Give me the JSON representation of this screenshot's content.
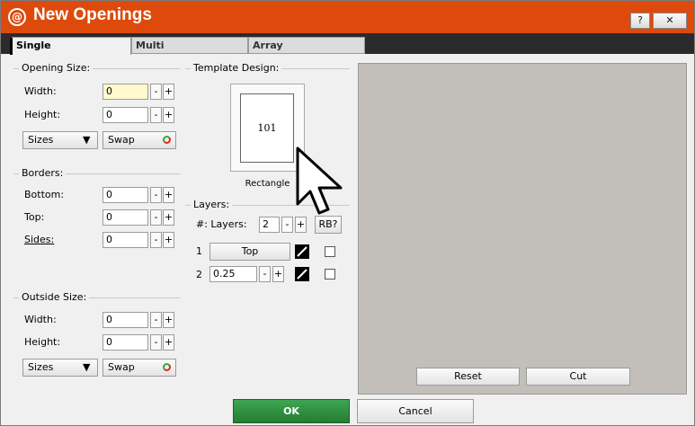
{
  "window": {
    "title": "New Openings",
    "logo": "@",
    "help_label": "?",
    "close_label": "✕"
  },
  "tabs": [
    {
      "label": "Single",
      "active": true
    },
    {
      "label": "Multi",
      "active": false
    },
    {
      "label": "Array",
      "active": false
    }
  ],
  "opening_size": {
    "group_label": "Opening Size:",
    "width_label": "Width:",
    "width_value": "0",
    "height_label": "Height:",
    "height_value": "0",
    "sizes_label": "Sizes",
    "swap_label": "Swap"
  },
  "borders": {
    "group_label": "Borders:",
    "bottom_label": "Bottom:",
    "bottom_value": "0",
    "top_label": "Top:",
    "top_value": "0",
    "sides_label": "Sides:",
    "sides_value": "0"
  },
  "outside_size": {
    "group_label": "Outside Size:",
    "width_label": "Width:",
    "width_value": "0",
    "height_label": "Height:",
    "height_value": "0",
    "sizes_label": "Sizes",
    "swap_label": "Swap"
  },
  "template_design": {
    "group_label": "Template Design:",
    "template_number": "101",
    "template_name": "Rectangle"
  },
  "layers": {
    "group_label": "Layers:",
    "count_label": "#: Layers:",
    "count_value": "2",
    "rb_label": "RB?",
    "rows": [
      {
        "index": "1",
        "value": "Top"
      },
      {
        "index": "2",
        "value": "0.25"
      }
    ]
  },
  "spin": {
    "minus": "-",
    "plus": "+"
  },
  "preview": {
    "reset_label": "Reset",
    "cut_label": "Cut"
  },
  "footer": {
    "ok_label": "OK",
    "cancel_label": "Cancel"
  },
  "colors": {
    "title_bar": "#dd4a0c",
    "ok_button": "#2e8b3a",
    "preview_bg": "#c2bfba",
    "highlight_input": "#fff9cc"
  },
  "icons": [
    "logo-icon",
    "help-icon",
    "close-icon",
    "dropdown-arrow-icon",
    "swap-icon",
    "pen-icon",
    "cursor-icon"
  ]
}
